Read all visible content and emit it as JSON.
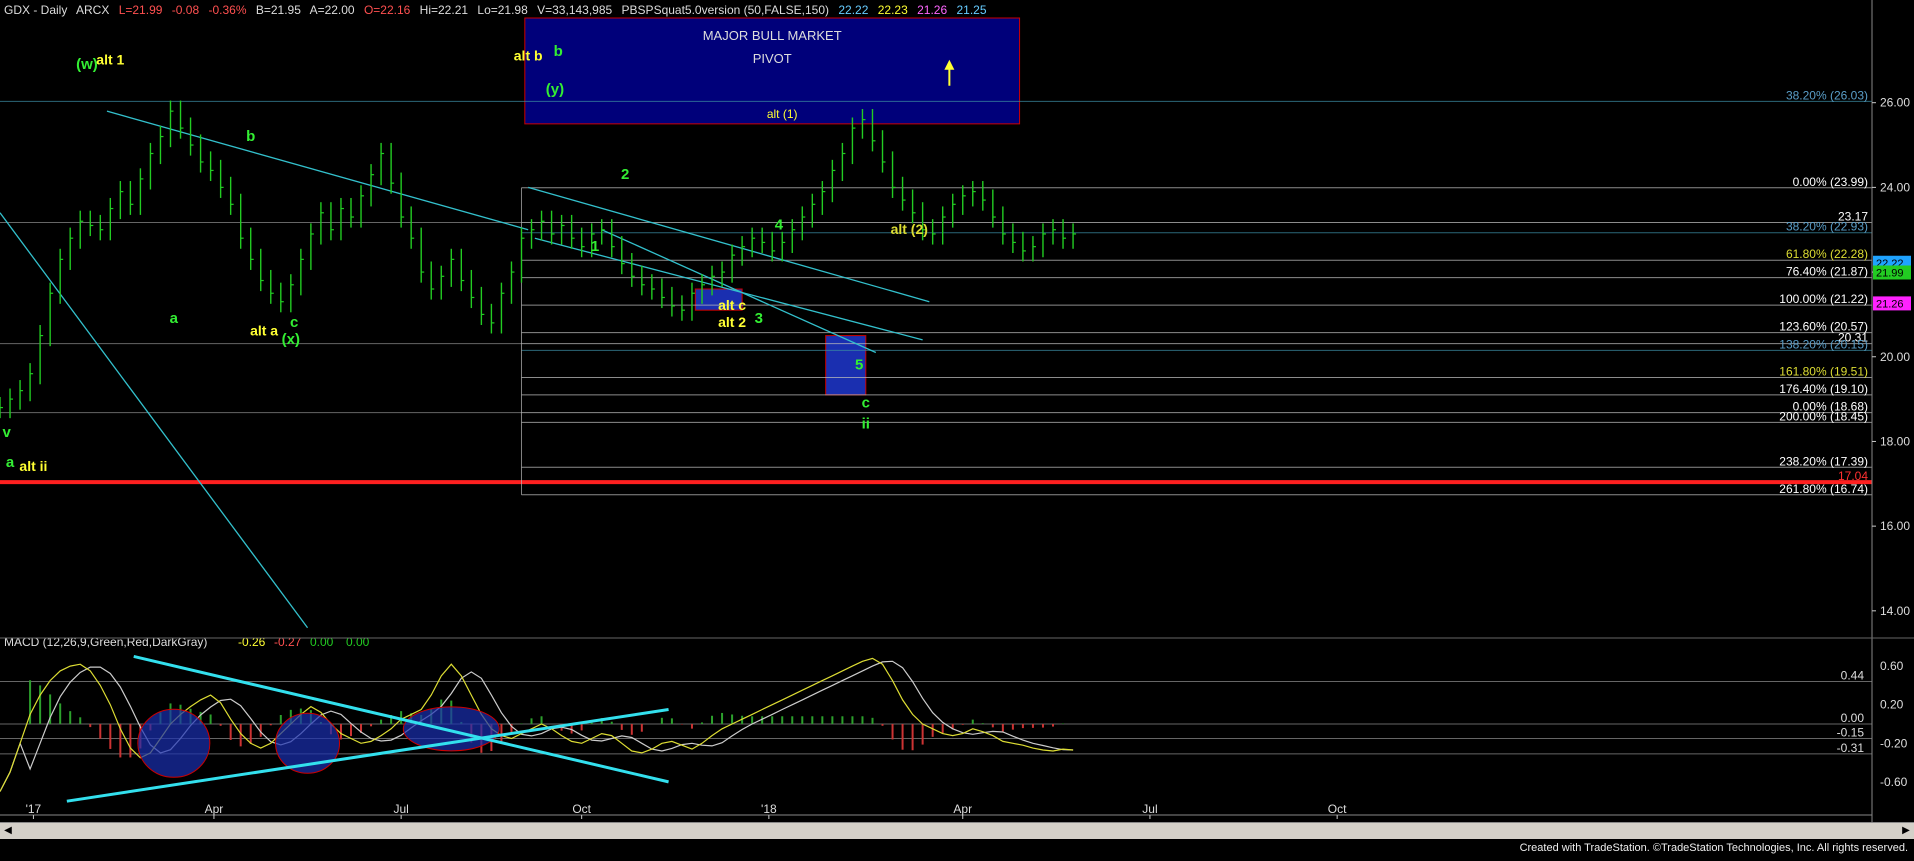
{
  "header": {
    "symbol": "GDX - Daily",
    "exchange": "ARCX",
    "last": "L=21.99",
    "change": "-0.08",
    "change_pct": "-0.36%",
    "bid": "B=21.95",
    "ask": "A=22.00",
    "open": "O=22.16",
    "high": "Hi=22.21",
    "low": "Lo=21.98",
    "volume": "V=33,143,985",
    "study": "PBSPSquat5.0version (50,FALSE,150)",
    "study_v1": "22.22",
    "study_v2": "22.23",
    "study_v3": "21.26",
    "study_v4": "21.25"
  },
  "colors": {
    "background": "#000000",
    "price_bar": "#22cc22",
    "trendline": "#33c0cc",
    "fib_line": "#c8c8c8",
    "pivot_fill": "#00007a",
    "pivot_border": "#cc0000",
    "support_line": "#ff2020",
    "label_green": "#33ee33",
    "label_yellow": "#ffff33",
    "macd_hist": "#2ca02c",
    "macd_line": "#dddd33",
    "macd_signal": "#cccccc",
    "macd_trendline": "#33e0ee"
  },
  "chart_data": [
    {
      "type": "line",
      "title": "GDX - Daily",
      "ylim": [
        13.5,
        28
      ],
      "y_ticks": [
        "26.00",
        "24.00",
        "22.00",
        "20.00",
        "18.00",
        "16.00",
        "14.00"
      ],
      "x_ticks": [
        "'17",
        "Apr",
        "Jul",
        "Oct",
        "'18",
        "Apr",
        "Jul",
        "Oct"
      ],
      "x": [
        0,
        3,
        6,
        9,
        12,
        15,
        18,
        21,
        24,
        27,
        30,
        33,
        36,
        39,
        42,
        45,
        48,
        51,
        54,
        57,
        60,
        63,
        66,
        69,
        72,
        75,
        78,
        81,
        84,
        87,
        90,
        93,
        96,
        99,
        102,
        105,
        108,
        111,
        114,
        117,
        120,
        123,
        126,
        129,
        132,
        135,
        138,
        141,
        144,
        147,
        150,
        153,
        156,
        159,
        162,
        165,
        168,
        171,
        174,
        177,
        180,
        183,
        186,
        189,
        192,
        195,
        198,
        201,
        204,
        207,
        210,
        213,
        216,
        219,
        222,
        225,
        228,
        231,
        234,
        237,
        240,
        243,
        246,
        249,
        252,
        255,
        258,
        261,
        264,
        267,
        270,
        273,
        276,
        279,
        282,
        285,
        288,
        291,
        294,
        297,
        300,
        303,
        306,
        309,
        312,
        315,
        318,
        321
      ],
      "series": [
        {
          "values": [
            18.8,
            19.0,
            19.2,
            19.6,
            20.5,
            21.5,
            22.3,
            22.8,
            23.2,
            23.1,
            23.0,
            23.5,
            23.9,
            23.6,
            24.2,
            24.8,
            25.2,
            25.8,
            25.4,
            25.0,
            24.6,
            24.4,
            24.0,
            23.6,
            22.8,
            22.3,
            21.8,
            21.5,
            21.3,
            21.7,
            22.3,
            22.9,
            23.4,
            23.0,
            23.5,
            23.3,
            23.8,
            24.3,
            24.8,
            24.1,
            23.3,
            22.8,
            22.0,
            21.6,
            21.9,
            22.3,
            21.8,
            21.4,
            21.0,
            20.8,
            21.5,
            22.0,
            22.8,
            23.0,
            23.2,
            22.9,
            23.1,
            22.8,
            22.6,
            22.9,
            23.0,
            22.6,
            22.2,
            21.9,
            21.7,
            21.6,
            21.4,
            21.2,
            21.1,
            21.5,
            21.7,
            21.9,
            22.0,
            22.4,
            22.6,
            22.8,
            22.7,
            22.5,
            22.7,
            23.0,
            23.3,
            23.6,
            23.9,
            24.4,
            24.8,
            25.4,
            25.6,
            25.1,
            24.6,
            24.0,
            23.7,
            23.4,
            23.0,
            22.9,
            23.3,
            23.6,
            23.8,
            23.9,
            23.7,
            23.3,
            22.9,
            22.7,
            22.5,
            22.6,
            22.9,
            23.0,
            22.8,
            22.9
          ]
        }
      ],
      "right_price_labels": {
        "current_1": "22.22",
        "current_2": "21.99",
        "pink": "21.26"
      },
      "pivot_box": {
        "label_1": "MAJOR BULL MARKET",
        "label_2": "PIVOT",
        "label_3": "alt (1)",
        "y_top": 28.0,
        "y_bottom": 25.5
      },
      "fib_levels": [
        {
          "label": "38.20% (26.03)",
          "value": 26.03,
          "color": "#5a9ec8"
        },
        {
          "label": "0.00% (23.99)",
          "value": 23.99,
          "color": "#ffffff"
        },
        {
          "label": "23.17",
          "value": 23.17,
          "color": "#ffffff"
        },
        {
          "label": "38.20% (22.93)",
          "value": 22.93,
          "color": "#5a9ec8"
        },
        {
          "label": "61.80% (22.28)",
          "value": 22.28,
          "color": "#dddd33"
        },
        {
          "label": "76.40% (21.87)",
          "value": 21.87,
          "color": "#ffffff"
        },
        {
          "label": "100.00% (21.22)",
          "value": 21.22,
          "color": "#ffffff"
        },
        {
          "label": "123.60% (20.57)",
          "value": 20.57,
          "color": "#ffffff"
        },
        {
          "label": "20.31",
          "value": 20.31,
          "color": "#ffffff"
        },
        {
          "label": "138.20% (20.15)",
          "value": 20.15,
          "color": "#5a9ec8"
        },
        {
          "label": "161.80% (19.51)",
          "value": 19.51,
          "color": "#dddd33"
        },
        {
          "label": "176.40% (19.10)",
          "value": 19.1,
          "color": "#ffffff"
        },
        {
          "label": "0.00% (18.68)",
          "value": 18.68,
          "color": "#ffffff"
        },
        {
          "label": "200.00% (18.45)",
          "value": 18.45,
          "color": "#ffffff"
        },
        {
          "label": "238.20% (17.39)",
          "value": 17.39,
          "color": "#ffffff"
        },
        {
          "label": "17.04",
          "value": 17.04,
          "color": "#ff3030"
        },
        {
          "label": "261.80% (16.74)",
          "value": 16.74,
          "color": "#ffffff"
        }
      ],
      "wave_labels": [
        {
          "text": "(w)",
          "x": 26,
          "y": 26.8,
          "color": "#33ee33"
        },
        {
          "text": "alt 1",
          "x": 33,
          "y": 26.9,
          "color": "#ffff33"
        },
        {
          "text": "b",
          "x": 75,
          "y": 25.1,
          "color": "#33ee33"
        },
        {
          "text": "a",
          "x": 52,
          "y": 20.8,
          "color": "#33ee33"
        },
        {
          "text": "c",
          "x": 88,
          "y": 20.7,
          "color": "#33ee33"
        },
        {
          "text": "alt a",
          "x": 79,
          "y": 20.5,
          "color": "#ffff33"
        },
        {
          "text": "(x)",
          "x": 87,
          "y": 20.3,
          "color": "#33ee33"
        },
        {
          "text": "v",
          "x": 2,
          "y": 18.1,
          "color": "#33ee33"
        },
        {
          "text": "a",
          "x": 3,
          "y": 17.4,
          "color": "#33ee33"
        },
        {
          "text": "alt ii",
          "x": 10,
          "y": 17.3,
          "color": "#ffff33"
        },
        {
          "text": "alt b",
          "x": 158,
          "y": 27.0,
          "color": "#ffff33"
        },
        {
          "text": "b",
          "x": 167,
          "y": 27.1,
          "color": "#33ee33"
        },
        {
          "text": "(y)",
          "x": 166,
          "y": 26.2,
          "color": "#33ee33"
        },
        {
          "text": "1",
          "x": 178,
          "y": 22.5,
          "color": "#33ee33"
        },
        {
          "text": "2",
          "x": 187,
          "y": 24.2,
          "color": "#33ee33"
        },
        {
          "text": "4",
          "x": 233,
          "y": 23.0,
          "color": "#33ee33"
        },
        {
          "text": "alt (2)",
          "x": 272,
          "y": 22.9,
          "color": "#dddd33"
        },
        {
          "text": "alt c",
          "x": 219,
          "y": 21.1,
          "color": "#ffff33"
        },
        {
          "text": "alt 2",
          "x": 219,
          "y": 20.7,
          "color": "#ffff33"
        },
        {
          "text": "3",
          "x": 227,
          "y": 20.8,
          "color": "#33ee33"
        },
        {
          "text": "5",
          "x": 257,
          "y": 19.7,
          "color": "#33ee33"
        },
        {
          "text": "c",
          "x": 259,
          "y": 18.8,
          "color": "#33ee33"
        },
        {
          "text": "ii",
          "x": 259,
          "y": 18.3,
          "color": "#33ee33"
        }
      ]
    },
    {
      "type": "line",
      "title": "MACD (12,26,9,Green,Red,DarkGray)",
      "legend_values": [
        "-0.26",
        "-0.27",
        "0.00",
        "0.00"
      ],
      "ylim": [
        -0.85,
        0.85
      ],
      "y_ticks": [
        "0.60",
        "0.20",
        "-0.20",
        "-0.60"
      ],
      "ref_levels": [
        {
          "label": "0.44",
          "value": 0.44
        },
        {
          "label": "0.00",
          "value": 0.0
        },
        {
          "label": "-0.15",
          "value": -0.15
        },
        {
          "label": "-0.31",
          "value": -0.31
        }
      ],
      "x": [
        0,
        3,
        6,
        9,
        12,
        15,
        18,
        21,
        24,
        27,
        30,
        33,
        36,
        39,
        42,
        45,
        48,
        51,
        54,
        57,
        60,
        63,
        66,
        69,
        72,
        75,
        78,
        81,
        84,
        87,
        90,
        93,
        96,
        99,
        102,
        105,
        108,
        111,
        114,
        117,
        120,
        123,
        126,
        129,
        132,
        135,
        138,
        141,
        144,
        147,
        150,
        153,
        156,
        159,
        162,
        165,
        168,
        171,
        174,
        177,
        180,
        183,
        186,
        189,
        192,
        195,
        198,
        201,
        204,
        207,
        210,
        213,
        216,
        219,
        222,
        225,
        228,
        231,
        234,
        237,
        240,
        243,
        246,
        249,
        252,
        255,
        258,
        261,
        264,
        267,
        270,
        273,
        276,
        279,
        282,
        285,
        288,
        291,
        294,
        297,
        300,
        303,
        306,
        309,
        312,
        315,
        318,
        321
      ],
      "series": [
        {
          "values": [
            -0.7,
            -0.5,
            -0.2,
            0.1,
            0.3,
            0.45,
            0.55,
            0.6,
            0.62,
            0.55,
            0.4,
            0.2,
            -0.05,
            -0.25,
            -0.35,
            -0.3,
            -0.15,
            0.0,
            0.1,
            0.18,
            0.25,
            0.3,
            0.22,
            0.05,
            -0.1,
            -0.2,
            -0.25,
            -0.2,
            -0.1,
            0.0,
            0.1,
            0.18,
            0.12,
            0.0,
            -0.1,
            -0.15,
            -0.2,
            -0.18,
            -0.12,
            -0.05,
            0.05,
            0.1,
            0.15,
            0.3,
            0.5,
            0.62,
            0.5,
            0.3,
            0.1,
            -0.05,
            -0.12,
            -0.15,
            -0.1,
            -0.05,
            0.0,
            -0.05,
            -0.12,
            -0.18,
            -0.2,
            -0.15,
            -0.1,
            -0.12,
            -0.2,
            -0.28,
            -0.3,
            -0.26,
            -0.2,
            -0.18,
            -0.22,
            -0.26,
            -0.2,
            -0.12,
            -0.05,
            0.0,
            0.05,
            0.1,
            0.15,
            0.2,
            0.25,
            0.3,
            0.35,
            0.4,
            0.45,
            0.5,
            0.55,
            0.6,
            0.65,
            0.68,
            0.62,
            0.45,
            0.25,
            0.1,
            0.0,
            -0.05,
            -0.1,
            -0.12,
            -0.1,
            -0.05,
            -0.08,
            -0.12,
            -0.18,
            -0.2,
            -0.22,
            -0.25,
            -0.27,
            -0.28,
            -0.26,
            -0.27
          ]
        }
      ]
    }
  ],
  "footer": {
    "credit": "Created with TradeStation. ©TradeStation Technologies, Inc. All rights reserved."
  }
}
